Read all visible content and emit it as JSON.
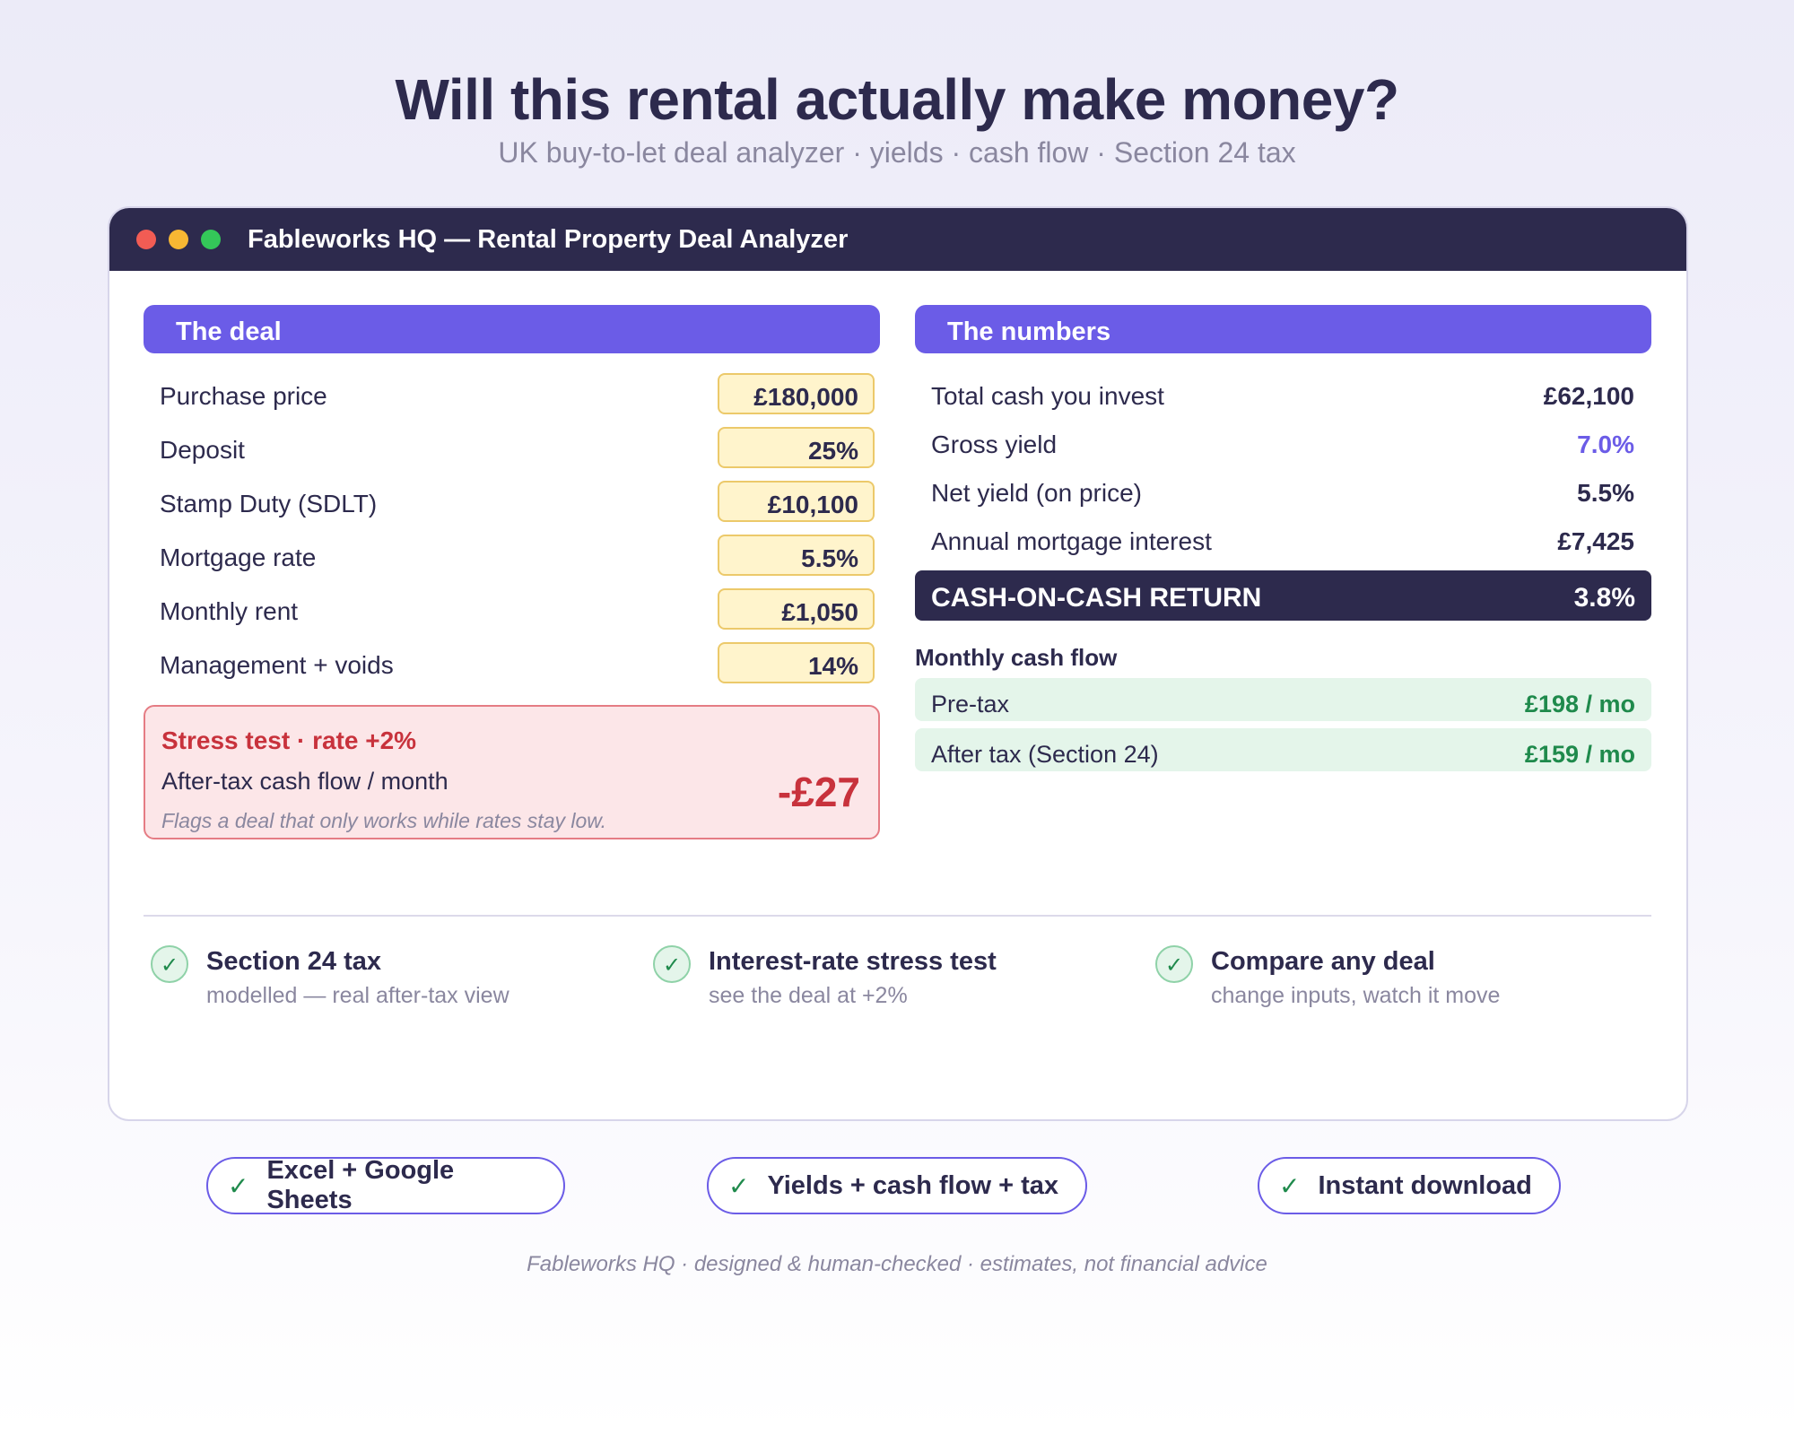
{
  "hero": {
    "title": "Will this rental actually make money?",
    "subtitle": "UK buy-to-let deal analyzer · yields · cash flow · Section 24 tax"
  },
  "window": {
    "title": "Fableworks HQ  —  Rental Property Deal Analyzer"
  },
  "deal": {
    "heading": "The deal",
    "inputs": [
      {
        "label": "Purchase price",
        "value": "£180,000"
      },
      {
        "label": "Deposit",
        "value": "25%"
      },
      {
        "label": "Stamp Duty (SDLT)",
        "value": "£10,100"
      },
      {
        "label": "Mortgage rate",
        "value": "5.5%"
      },
      {
        "label": "Monthly rent",
        "value": "£1,050"
      },
      {
        "label": "Management + voids",
        "value": "14%"
      }
    ],
    "stress": {
      "title": "Stress test  ·  rate +2%",
      "label": "After-tax cash flow / month",
      "value": "-£27",
      "note": "Flags a deal that only works while rates stay low."
    }
  },
  "numbers": {
    "heading": "The numbers",
    "rows": [
      {
        "label": "Total cash you invest",
        "value": "£62,100"
      },
      {
        "label": "Gross yield",
        "value": "7.0%"
      },
      {
        "label": "Net yield (on price)",
        "value": "5.5%"
      },
      {
        "label": "Annual mortgage interest",
        "value": "£7,425"
      }
    ],
    "coc": {
      "label": "CASH-ON-CASH RETURN",
      "value": "3.8%"
    },
    "monthly": {
      "heading": "Monthly cash flow",
      "rows": [
        {
          "label": "Pre-tax",
          "value": "£198 / mo"
        },
        {
          "label": "After tax (Section 24)",
          "value": "£159 / mo"
        }
      ]
    }
  },
  "features": [
    {
      "title": "Section 24 tax",
      "sub": "modelled — real after-tax view",
      "icon": "check-icon"
    },
    {
      "title": "Interest-rate stress test",
      "sub": "see the deal at +2%",
      "icon": "check-icon"
    },
    {
      "title": "Compare any deal",
      "sub": "change inputs, watch it move",
      "icon": "check-icon"
    }
  ],
  "pills": [
    {
      "check": "✓",
      "label": "Excel + Google Sheets"
    },
    {
      "check": "✓",
      "label": "Yields + cash flow + tax"
    },
    {
      "check": "✓",
      "label": "Instant download"
    }
  ],
  "check_glyph": "✓",
  "footer": "Fableworks HQ  ·  designed & human-checked  ·  estimates, not financial advice",
  "colors": {
    "navy": "#2d2a4d",
    "purple": "#6b5ce7",
    "input_fill": "#fff4cc",
    "stress_red": "#c8323c",
    "green": "#1f8a4c"
  }
}
